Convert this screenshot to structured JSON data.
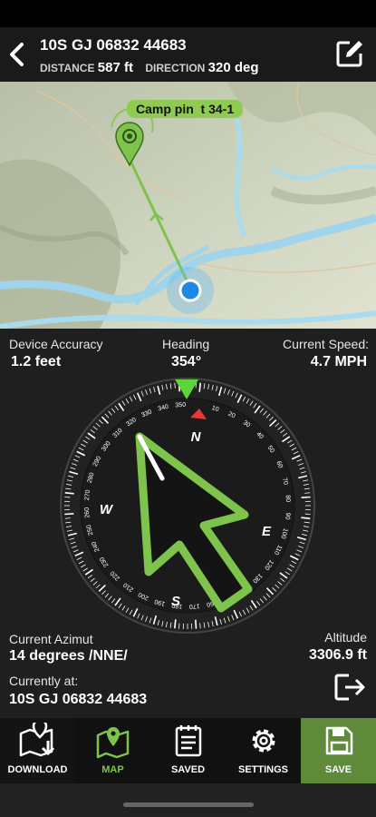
{
  "header": {
    "coordinate": "10S GJ 06832 44683",
    "distance_label": "DISTANCE",
    "distance_value": "587 ft",
    "direction_label": "DIRECTION",
    "direction_value": "320 deg"
  },
  "map": {
    "pin_label": "Camp pin  t 34-1"
  },
  "stats": {
    "accuracy_label": "Device Accuracy",
    "accuracy_value": "1.2 feet",
    "heading_label": "Heading",
    "heading_value": "354°",
    "speed_label": "Current Speed:",
    "speed_value": "4.7 MPH",
    "azimuth_label": "Current Azimut",
    "azimuth_value": "14 degrees /NNE/",
    "altitude_label": "Altitude",
    "altitude_value": "3306.9 ft",
    "location_label": "Currently at:",
    "location_value": "10S GJ 06832 44683"
  },
  "compass": {
    "north": "N",
    "east": "E",
    "south": "S",
    "west": "W",
    "heading_deg": 354,
    "dial_labels": [
      "10",
      "20",
      "30",
      "40",
      "50",
      "60",
      "70",
      "80",
      "90",
      "100",
      "110",
      "120",
      "130",
      "140",
      "150",
      "160",
      "170",
      "180",
      "190",
      "200",
      "210",
      "220",
      "230",
      "240",
      "250",
      "260",
      "270",
      "280",
      "290",
      "300",
      "310",
      "320",
      "330",
      "340",
      "350"
    ]
  },
  "nav": {
    "items": [
      {
        "label": "DOWNLOAD",
        "icon": "map-download-icon"
      },
      {
        "label": "MAP",
        "icon": "map-pin-icon"
      },
      {
        "label": "SAVED",
        "icon": "notepad-icon"
      },
      {
        "label": "SETTINGS",
        "icon": "gear-icon"
      },
      {
        "label": "SAVE",
        "icon": "floppy-disk-icon"
      }
    ]
  },
  "colors": {
    "accent": "#7ec34b",
    "background": "#1e1f1e",
    "location_dot": "#1e88e5",
    "red_marker": "#e53935"
  }
}
